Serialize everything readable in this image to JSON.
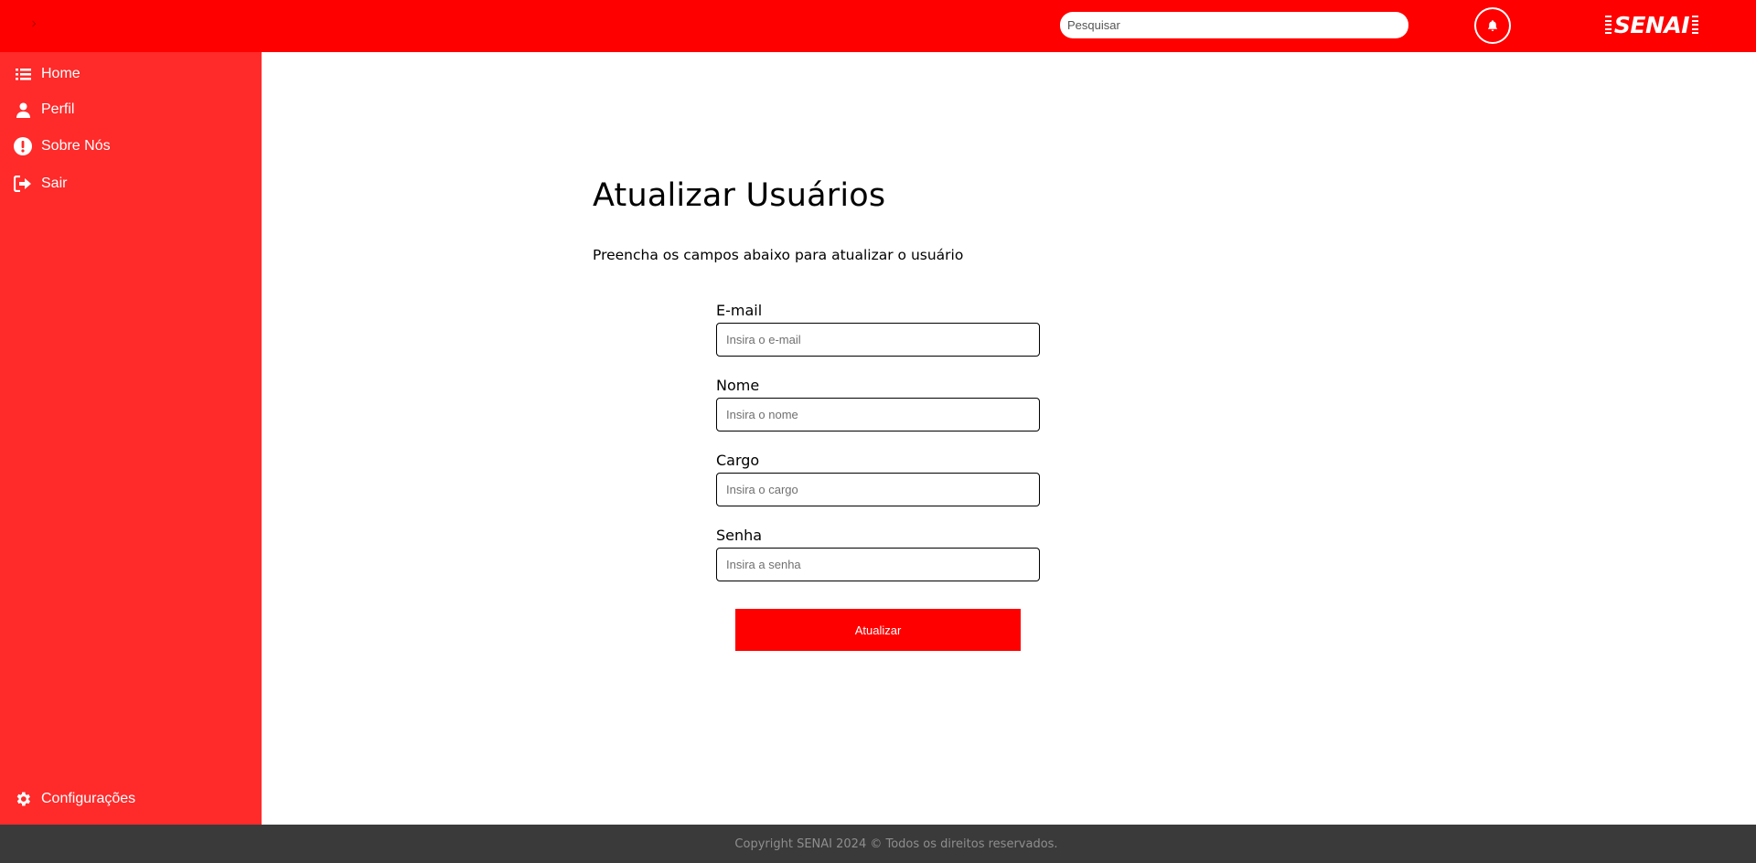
{
  "header": {
    "toggle_glyph": "›",
    "search_placeholder": "Pesquisar",
    "logo_text": "SENAI",
    "brand_color": "#ff0000",
    "bell_icon": "bell-icon"
  },
  "sidebar": {
    "background": "#ff2a2a",
    "items": [
      {
        "label": "Home",
        "icon": "list-icon"
      },
      {
        "label": "Perfil",
        "icon": "user-icon"
      },
      {
        "label": "Sobre Nós",
        "icon": "exclamation-circle-icon"
      },
      {
        "label": "Sair",
        "icon": "sign-out-icon"
      }
    ],
    "settings": {
      "label": "Configurações",
      "icon": "gear-icon"
    }
  },
  "main": {
    "title": "Atualizar Usuários",
    "subtitle": "Preencha os campos abaixo para atualizar o usuário",
    "fields": [
      {
        "label": "E-mail",
        "placeholder": "Insira o e-mail",
        "value": ""
      },
      {
        "label": "Nome",
        "placeholder": "Insira o nome",
        "value": ""
      },
      {
        "label": "Cargo",
        "placeholder": "Insira o cargo",
        "value": ""
      },
      {
        "label": "Senha",
        "placeholder": "Insira a senha",
        "value": ""
      }
    ],
    "submit_label": "Atualizar"
  },
  "footer": {
    "text": "Copyright SENAI 2024 © Todos os direitos reservados.",
    "background": "#3a3a3a"
  }
}
